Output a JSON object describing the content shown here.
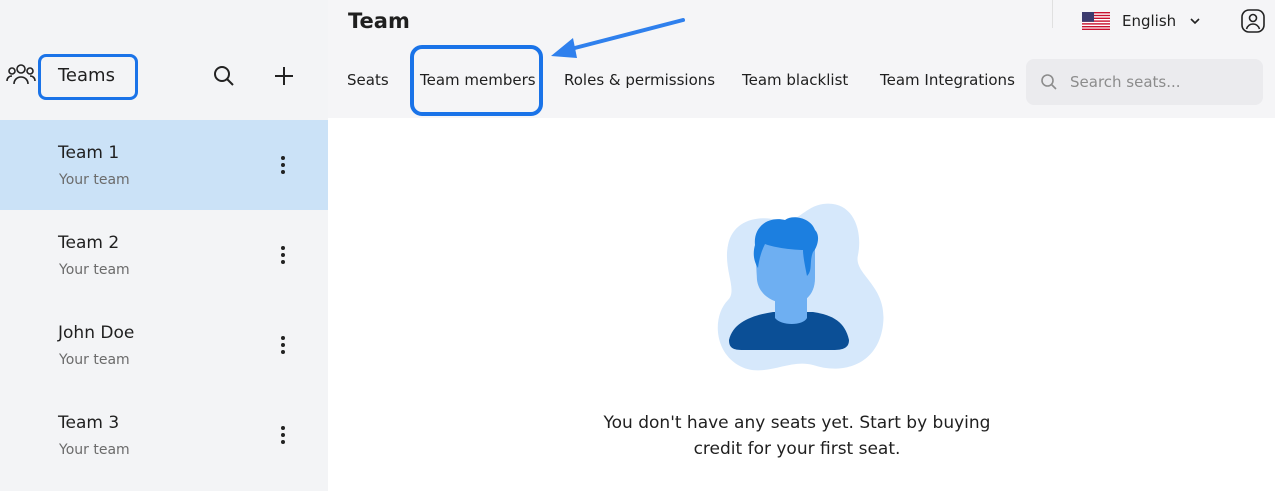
{
  "sidebar": {
    "title": "Teams",
    "teams": [
      {
        "name": "Team 1",
        "subtitle": "Your team",
        "active": true
      },
      {
        "name": "Team 2",
        "subtitle": "Your team",
        "active": false
      },
      {
        "name": "John Doe",
        "subtitle": "Your team",
        "active": false
      },
      {
        "name": "Team 3",
        "subtitle": "Your team",
        "active": false
      }
    ]
  },
  "header": {
    "title": "Team",
    "language": "English"
  },
  "tabs": [
    {
      "label": "Seats"
    },
    {
      "label": "Team members"
    },
    {
      "label": "Roles & permissions"
    },
    {
      "label": "Team blacklist"
    },
    {
      "label": "Team Integrations"
    }
  ],
  "search": {
    "placeholder": "Search seats...",
    "value": ""
  },
  "empty_state": {
    "line1": "You don't have any seats yet. Start by buying",
    "line2": "credit for your first seat."
  },
  "colors": {
    "accent": "#1a73e8",
    "active_row": "#cbe2f7",
    "sidebar_bg": "#f3f4f6",
    "illustration_blob": "#d6e8fb",
    "illustration_face": "#6eaff2",
    "illustration_hair": "#1c7fe0",
    "illustration_shirt": "#0b4f96"
  },
  "icons": {
    "teams": "people-group-icon",
    "search": "search-icon",
    "add": "plus-icon",
    "more": "kebab-menu-icon",
    "flag": "us-flag-icon",
    "chevron": "chevron-down-icon",
    "account": "user-account-icon"
  }
}
